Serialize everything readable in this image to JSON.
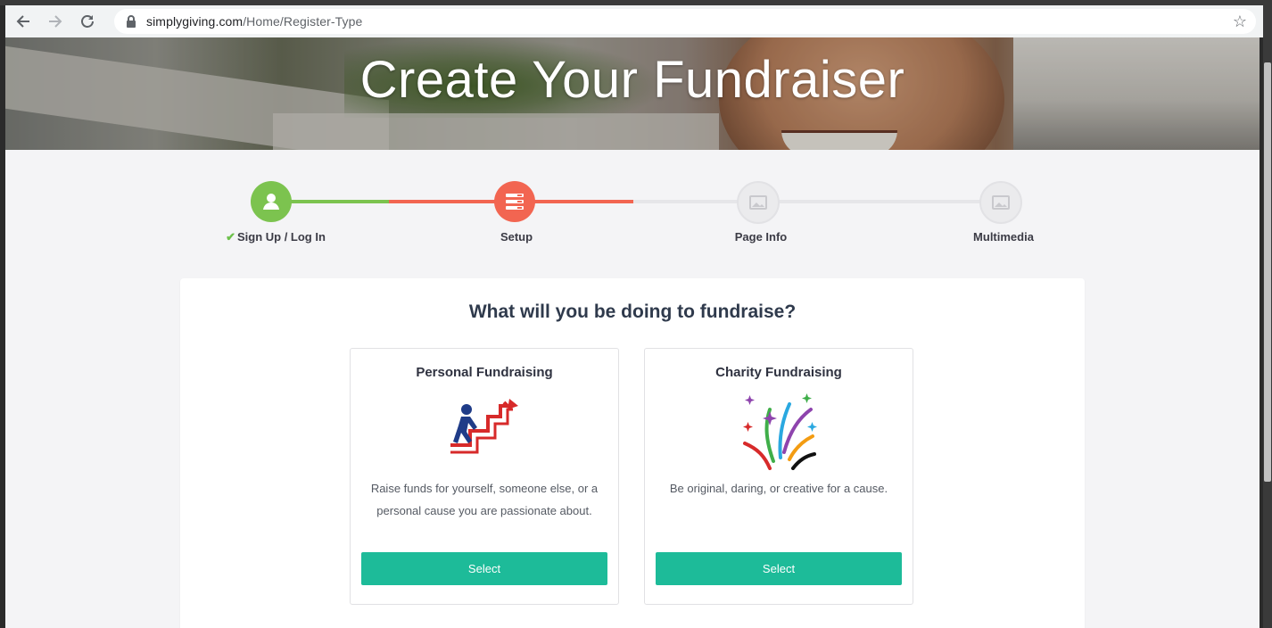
{
  "browser": {
    "url_host": "simplygiving.com",
    "url_path": "/Home/Register-Type"
  },
  "hero": {
    "title": "Create Your Fundraiser"
  },
  "steps": [
    {
      "label": "Sign Up / Log In",
      "state": "complete",
      "color": "#7cc34f",
      "icon": "user-icon"
    },
    {
      "label": "Setup",
      "state": "current",
      "color": "#f26551",
      "icon": "list-icon"
    },
    {
      "label": "Page Info",
      "state": "pending",
      "color": "#e8e8e8",
      "icon": "image-icon"
    },
    {
      "label": "Multimedia",
      "state": "pending",
      "color": "#e8e8e8",
      "icon": "image-icon"
    }
  ],
  "main": {
    "question": "What will you be doing to fundraise?",
    "options": [
      {
        "title": "Personal Fundraising",
        "description": "Raise funds for yourself, someone else, or a personal cause you are passionate about.",
        "button": "Select",
        "icon": "climbing-person-icon"
      },
      {
        "title": "Charity Fundraising",
        "description": "Be original, daring, or creative for a cause.",
        "button": "Select",
        "icon": "fireworks-icon"
      }
    ]
  },
  "colors": {
    "accent": "#1dbb99",
    "complete": "#7cc34f",
    "current": "#f26551"
  }
}
